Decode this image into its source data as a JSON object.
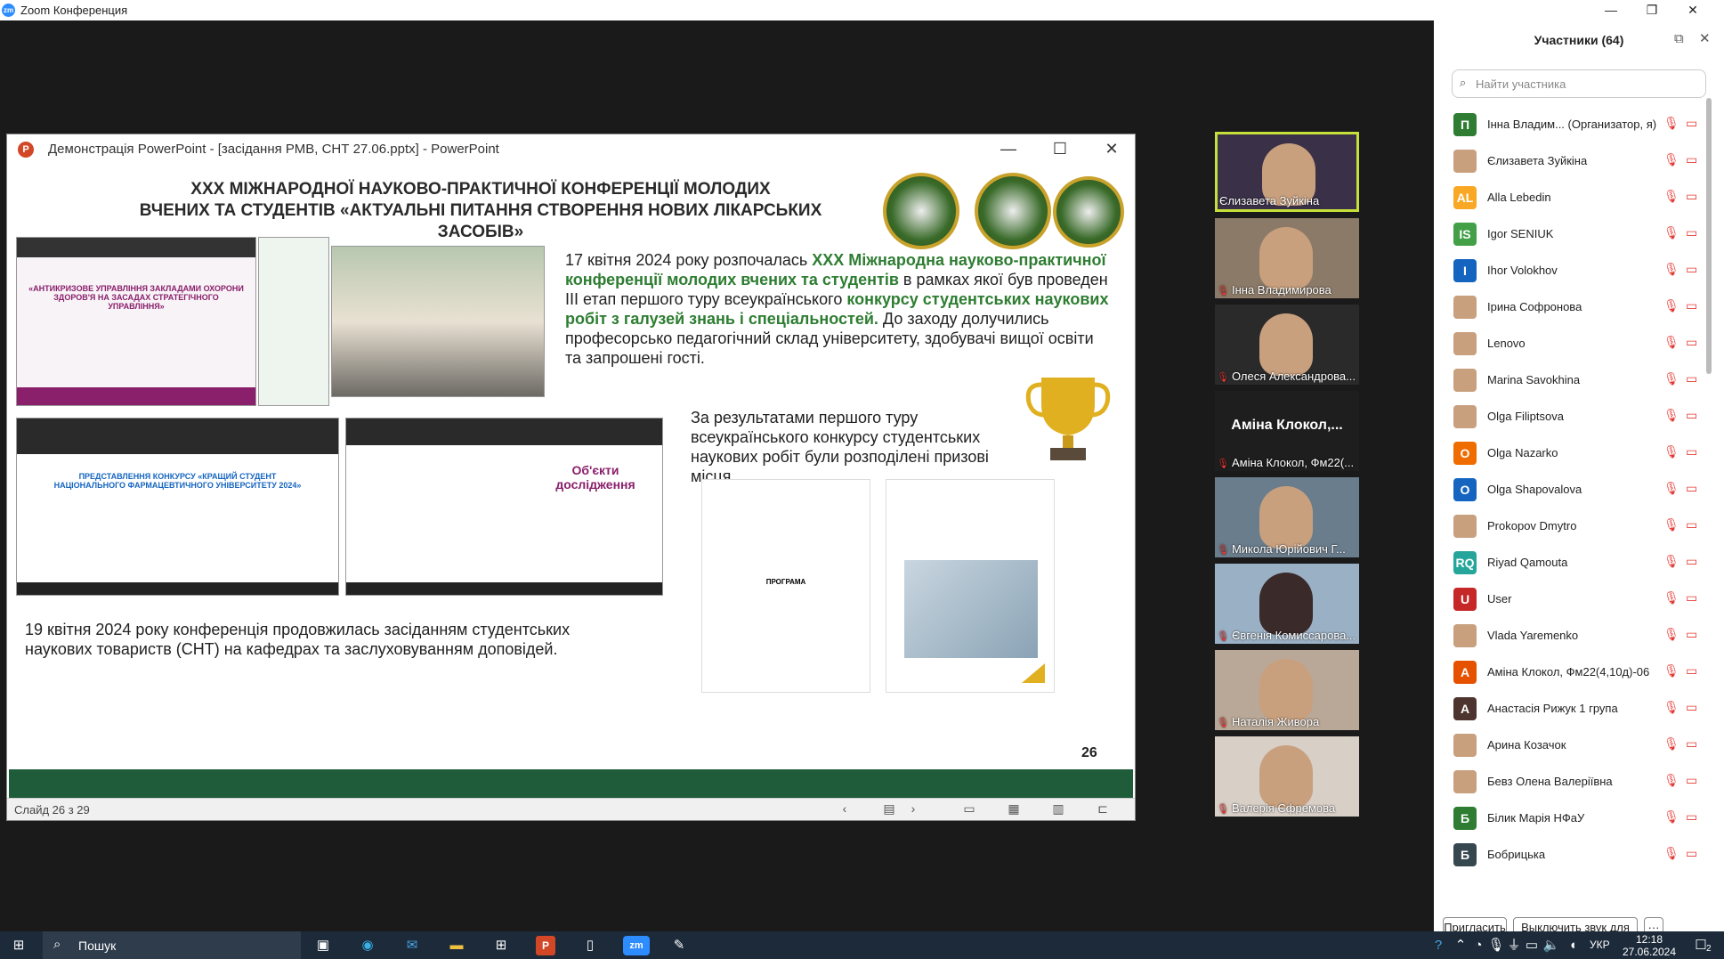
{
  "zoom": {
    "title": "Zoom Конференция",
    "minimize": "—",
    "restore": "❐",
    "close": "✕"
  },
  "ppt": {
    "title": "Демонстрація PowerPoint - [засідання РМВ, СНТ 27.06.pptx] - PowerPoint",
    "status": "Слайд 26 з 29"
  },
  "slide": {
    "title_line1": "XXX МІЖНАРОДНОЇ НАУКОВО-ПРАКТИЧНОЇ КОНФЕРЕНЦІЇ МОЛОДИХ",
    "title_line2": "ВЧЕНИХ ТА СТУДЕНТІВ «АКТУАЛЬНІ ПИТАННЯ СТВОРЕННЯ НОВИХ ЛІКАРСЬКИХ ЗАСОБІВ»",
    "p1_a": "17 квітня 2024 року розпочалась ",
    "p1_b": "XXX Міжнародна науково-практичної конференції молодих вчених та студентів",
    "p1_c": " в рамках якої був проведен ІІІ етап першого туру всеукраїнського ",
    "p1_d": "конкурсу студентських наукових робіт з галузей знань і спеціальностей.",
    "p1_e": " До заходу долучились професорсько педагогічний склад університету, здобувачі вищої освіти та запрошені гості.",
    "p2": "За результатами першого туру всеукраїнського конкурсу студентських наукових робіт були розподілені призові місця",
    "p3": "19 квітня 2024 року конференція продовжилась засіданням студентських наукових товариств (СНТ) на кафедрах та заслуховуванням доповідей.",
    "thumb1_text": "«АНТИКРИЗОВЕ УПРАВЛІННЯ ЗАКЛАДАМИ ОХОРОНИ ЗДОРОВ'Я НА ЗАСАДАХ СТРАТЕГІЧНОГО УПРАВЛІННЯ»",
    "thumb3_text": "ПРЕДСТАВЛЕННЯ КОНКУРСУ «КРАЩИЙ СТУДЕНТ НАЦІОНАЛЬНОГО ФАРМАЦЕВТИЧНОГО УНІВЕРСИТЕТУ 2024»",
    "thumb4_text": "Об'єкти дослідження",
    "doc1_text": "ПРОГРАМА",
    "page_num": "26"
  },
  "participants": {
    "title": "Участники (64)",
    "search_placeholder": "Найти участника",
    "list": [
      {
        "initial": "П",
        "color": "#2e7d32",
        "name": "Інна Владим...  (Организатор, я)"
      },
      {
        "initial": "",
        "color": "photo",
        "name": "Єлизавета Зуйкіна"
      },
      {
        "initial": "AL",
        "color": "#f9a825",
        "name": "Alla Lebedin"
      },
      {
        "initial": "IS",
        "color": "#43a047",
        "name": "Igor SENIUK"
      },
      {
        "initial": "I",
        "color": "#1565c0",
        "name": "Ihor Volokhov"
      },
      {
        "initial": "",
        "color": "photo",
        "name": "Ірина Софронова"
      },
      {
        "initial": "",
        "color": "photo",
        "name": "Lenovo"
      },
      {
        "initial": "",
        "color": "photo",
        "name": "Marina Savokhina"
      },
      {
        "initial": "",
        "color": "photo",
        "name": "Olga Filiptsova"
      },
      {
        "initial": "O",
        "color": "#ef6c00",
        "name": "Olga Nazarko"
      },
      {
        "initial": "O",
        "color": "#1565c0",
        "name": "Olga Shapovalova"
      },
      {
        "initial": "",
        "color": "photo",
        "name": "Prokopov Dmytro"
      },
      {
        "initial": "RQ",
        "color": "#26a69a",
        "name": "Riyad Qamouta"
      },
      {
        "initial": "U",
        "color": "#c62828",
        "name": "User"
      },
      {
        "initial": "",
        "color": "photo",
        "name": "Vlada Yaremenko"
      },
      {
        "initial": "А",
        "color": "#e65100",
        "name": "Аміна Клокол, Фм22(4,10д)-06"
      },
      {
        "initial": "А",
        "color": "#4e342e",
        "name": "Анастасія Рижук 1 група"
      },
      {
        "initial": "",
        "color": "photo",
        "name": "Арина Козачок"
      },
      {
        "initial": "",
        "color": "photo",
        "name": "Бевз Олена Валеріївна"
      },
      {
        "initial": "Б",
        "color": "#2e7d32",
        "name": "Білик Марія НФаУ"
      },
      {
        "initial": "Б",
        "color": "#37474f",
        "name": "Бобрицька"
      }
    ],
    "invite": "Пригласить",
    "mute_all": "Выключить звук для всех",
    "more": "···"
  },
  "gallery": [
    {
      "name": "Єлизавета Зуйкіна",
      "muted": false
    },
    {
      "name": "Інна Владимирова",
      "muted": true
    },
    {
      "name": "Олеся Александрова...",
      "muted": true
    },
    {
      "name": "Аміна Клокол, Фм22(...",
      "muted": true,
      "big_name": "Аміна Клокол,..."
    },
    {
      "name": "Микола Юрійович Г...",
      "muted": true
    },
    {
      "name": "Євгенія Комиссарова...",
      "muted": true
    },
    {
      "name": "Наталія Живора",
      "muted": true
    },
    {
      "name": "Валерія Єфремова",
      "muted": true
    }
  ],
  "taskbar": {
    "search": "Пошук",
    "lang": "УКР",
    "time": "12:18",
    "date": "27.06.2024",
    "notif": "2"
  }
}
